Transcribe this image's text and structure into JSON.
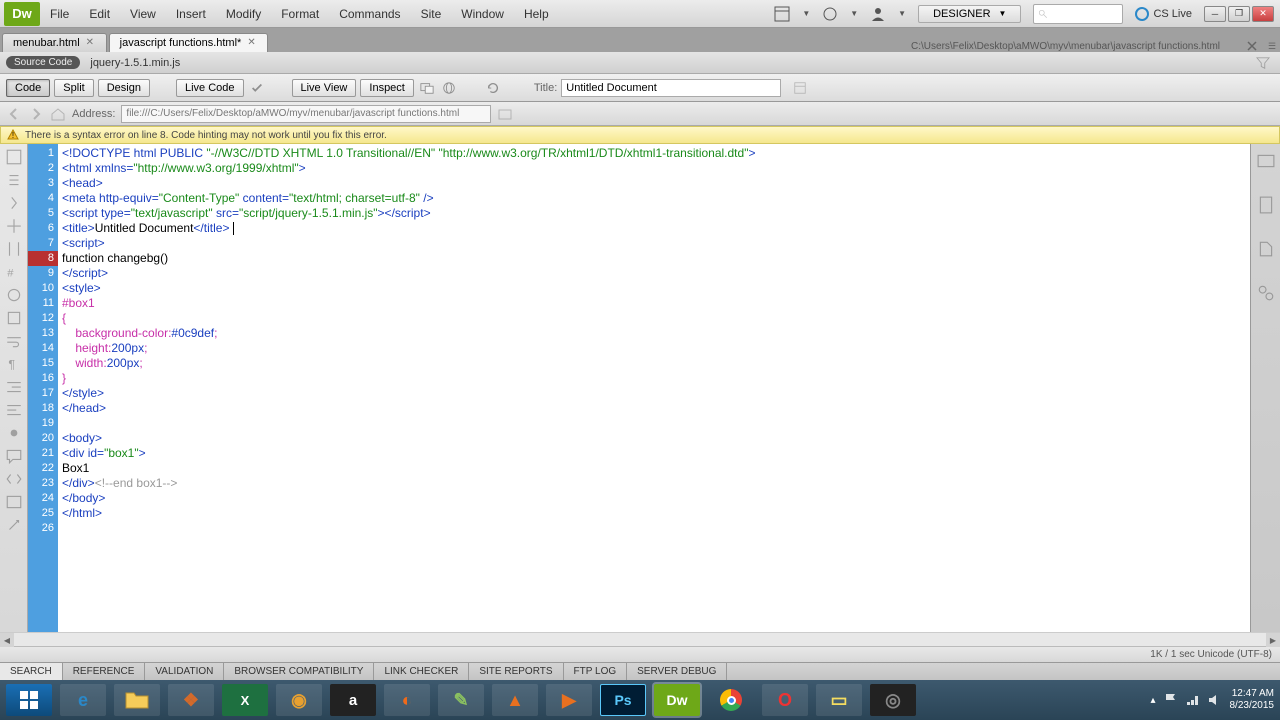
{
  "app": {
    "logo_text": "Dw"
  },
  "menu": {
    "items": [
      "File",
      "Edit",
      "View",
      "Insert",
      "Modify",
      "Format",
      "Commands",
      "Site",
      "Window",
      "Help"
    ]
  },
  "workspace": {
    "label": "DESIGNER"
  },
  "cslive": {
    "label": "CS Live"
  },
  "tabs": [
    {
      "label": "menubar.html",
      "active": false
    },
    {
      "label": "javascript functions.html*",
      "active": true
    }
  ],
  "doc_path": "C:\\Users\\Felix\\Desktop\\aMWO\\myv\\menubar\\javascript functions.html",
  "source_row": {
    "pill": "Source Code",
    "link": "jquery-1.5.1.min.js"
  },
  "view_buttons": {
    "code": "Code",
    "split": "Split",
    "design": "Design",
    "livecode": "Live Code",
    "liveview": "Live View",
    "inspect": "Inspect"
  },
  "title_field": {
    "label": "Title:",
    "value": "Untitled Document"
  },
  "address": {
    "label": "Address:",
    "value": "file:///C:/Users/Felix/Desktop/aMWO/myv/menubar/javascript functions.html"
  },
  "warning": "There is a syntax error on line 8.  Code hinting may not work until you fix this error.",
  "code_lines": [
    {
      "n": 1,
      "html": "<span class='tok-tag'>&lt;!DOCTYPE html PUBLIC </span><span class='tok-str'>\"-//W3C//DTD XHTML 1.0 Transitional//EN\" \"http://www.w3.org/TR/xhtml1/DTD/xhtml1-transitional.dtd\"</span><span class='tok-tag'>&gt;</span>"
    },
    {
      "n": 2,
      "html": "<span class='tok-tag'>&lt;html</span> <span class='tok-attr'>xmlns=</span><span class='tok-str'>\"http://www.w3.org/1999/xhtml\"</span><span class='tok-tag'>&gt;</span>"
    },
    {
      "n": 3,
      "html": "<span class='tok-tag'>&lt;head&gt;</span>"
    },
    {
      "n": 4,
      "html": "<span class='tok-tag'>&lt;meta</span> <span class='tok-attr'>http-equiv=</span><span class='tok-str'>\"Content-Type\"</span> <span class='tok-attr'>content=</span><span class='tok-str'>\"text/html; charset=utf-8\"</span> <span class='tok-tag'>/&gt;</span>"
    },
    {
      "n": 5,
      "html": "<span class='tok-tag'>&lt;script</span> <span class='tok-attr'>type=</span><span class='tok-str'>\"text/javascript\"</span> <span class='tok-attr'>src=</span><span class='tok-str'>\"script/jquery-1.5.1.min.js\"</span><span class='tok-tag'>&gt;&lt;/script&gt;</span>"
    },
    {
      "n": 6,
      "html": "<span class='tok-tag'>&lt;title&gt;</span><span class='tok-text'>Untitled Document</span><span class='tok-tag'>&lt;/title&gt;</span> <span class='cursor'></span>"
    },
    {
      "n": 7,
      "html": "<span class='tok-tag'>&lt;script&gt;</span>"
    },
    {
      "n": 8,
      "err": true,
      "html": "<span class='tok-text'>function changebg()</span>"
    },
    {
      "n": 9,
      "html": "<span class='tok-tag'>&lt;/script&gt;</span>"
    },
    {
      "n": 10,
      "html": "<span class='tok-tag'>&lt;style&gt;</span>"
    },
    {
      "n": 11,
      "html": "<span class='tok-css'>#box1</span>"
    },
    {
      "n": 12,
      "html": "<span class='tok-css'>{</span>"
    },
    {
      "n": 13,
      "html": "    <span class='tok-css'>background-color:</span><span class='tok-cssval'>#0c9def</span><span class='tok-css'>;</span>"
    },
    {
      "n": 14,
      "html": "    <span class='tok-css'>height:</span><span class='tok-cssval'>200px</span><span class='tok-css'>;</span>"
    },
    {
      "n": 15,
      "html": "    <span class='tok-css'>width:</span><span class='tok-cssval'>200px</span><span class='tok-css'>;</span>"
    },
    {
      "n": 16,
      "html": "<span class='tok-css'>}</span>"
    },
    {
      "n": 17,
      "html": "<span class='tok-tag'>&lt;/style&gt;</span>"
    },
    {
      "n": 18,
      "html": "<span class='tok-tag'>&lt;/head&gt;</span>"
    },
    {
      "n": 19,
      "html": ""
    },
    {
      "n": 20,
      "html": "<span class='tok-tag'>&lt;body&gt;</span>"
    },
    {
      "n": 21,
      "html": "<span class='tok-tag'>&lt;div</span> <span class='tok-attr'>id=</span><span class='tok-str'>\"box1\"</span><span class='tok-tag'>&gt;</span>"
    },
    {
      "n": 22,
      "html": "<span class='tok-text'>Box1</span>"
    },
    {
      "n": 23,
      "html": "<span class='tok-tag'>&lt;/div&gt;</span><span class='tok-comment'>&lt;!--end box1--&gt;</span>"
    },
    {
      "n": 24,
      "html": "<span class='tok-tag'>&lt;/body&gt;</span>"
    },
    {
      "n": 25,
      "html": "<span class='tok-tag'>&lt;/html&gt;</span>"
    },
    {
      "n": 26,
      "html": ""
    }
  ],
  "status": "1K / 1 sec  Unicode (UTF-8)",
  "bottom_tabs": [
    "SEARCH",
    "REFERENCE",
    "VALIDATION",
    "BROWSER COMPATIBILITY",
    "LINK CHECKER",
    "SITE REPORTS",
    "FTP LOG",
    "SERVER DEBUG"
  ],
  "clock": {
    "time": "12:47 AM",
    "date": "8/23/2015"
  }
}
